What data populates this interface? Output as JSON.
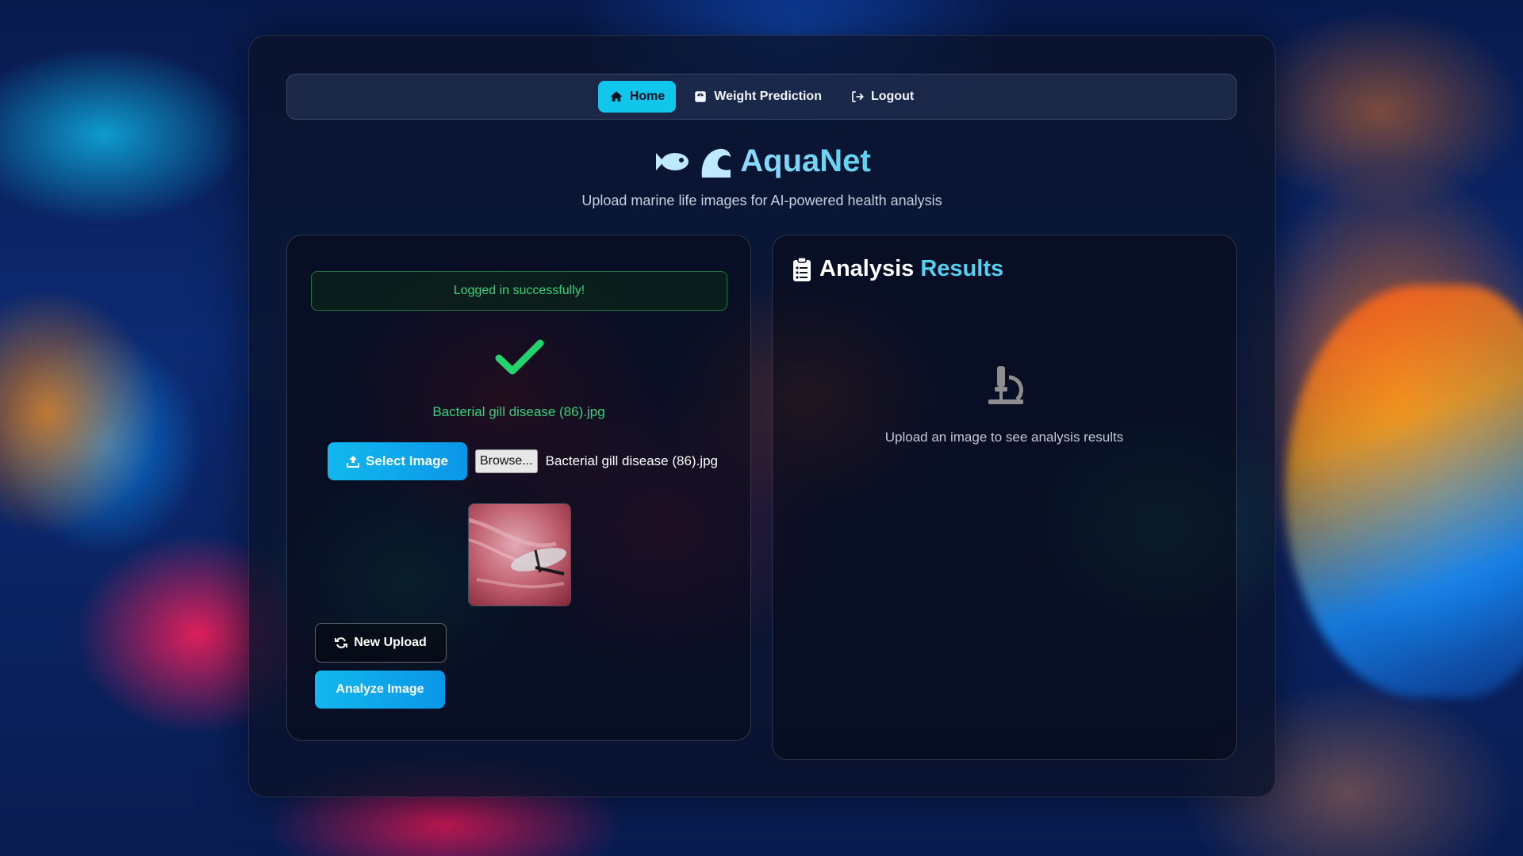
{
  "nav": {
    "items": [
      {
        "label": "Home",
        "icon": "home-icon",
        "active": true
      },
      {
        "label": "Weight Prediction",
        "icon": "weight-icon",
        "active": false
      },
      {
        "label": "Logout",
        "icon": "logout-icon",
        "active": false
      }
    ]
  },
  "brand": {
    "title": "AquaNet",
    "subtitle": "Upload marine life images for AI-powered health analysis",
    "icons": [
      "fish-icon",
      "wave-icon"
    ]
  },
  "upload": {
    "alert": "Logged in successfully!",
    "selected_file_display": "Bacterial gill disease (86).jpg",
    "select_button": "Select Image",
    "browse_button": "Browse...",
    "file_input_value": "Bacterial gill disease (86).jpg",
    "new_upload_button": "New Upload",
    "analyze_button": "Analyze Image"
  },
  "results": {
    "title_part1": "Analysis",
    "title_part2": "Results",
    "empty_message": "Upload an image to see analysis results"
  },
  "colors": {
    "accent": "#10c6ea",
    "success": "#35d27a",
    "panel_bg": "#0a1228"
  }
}
